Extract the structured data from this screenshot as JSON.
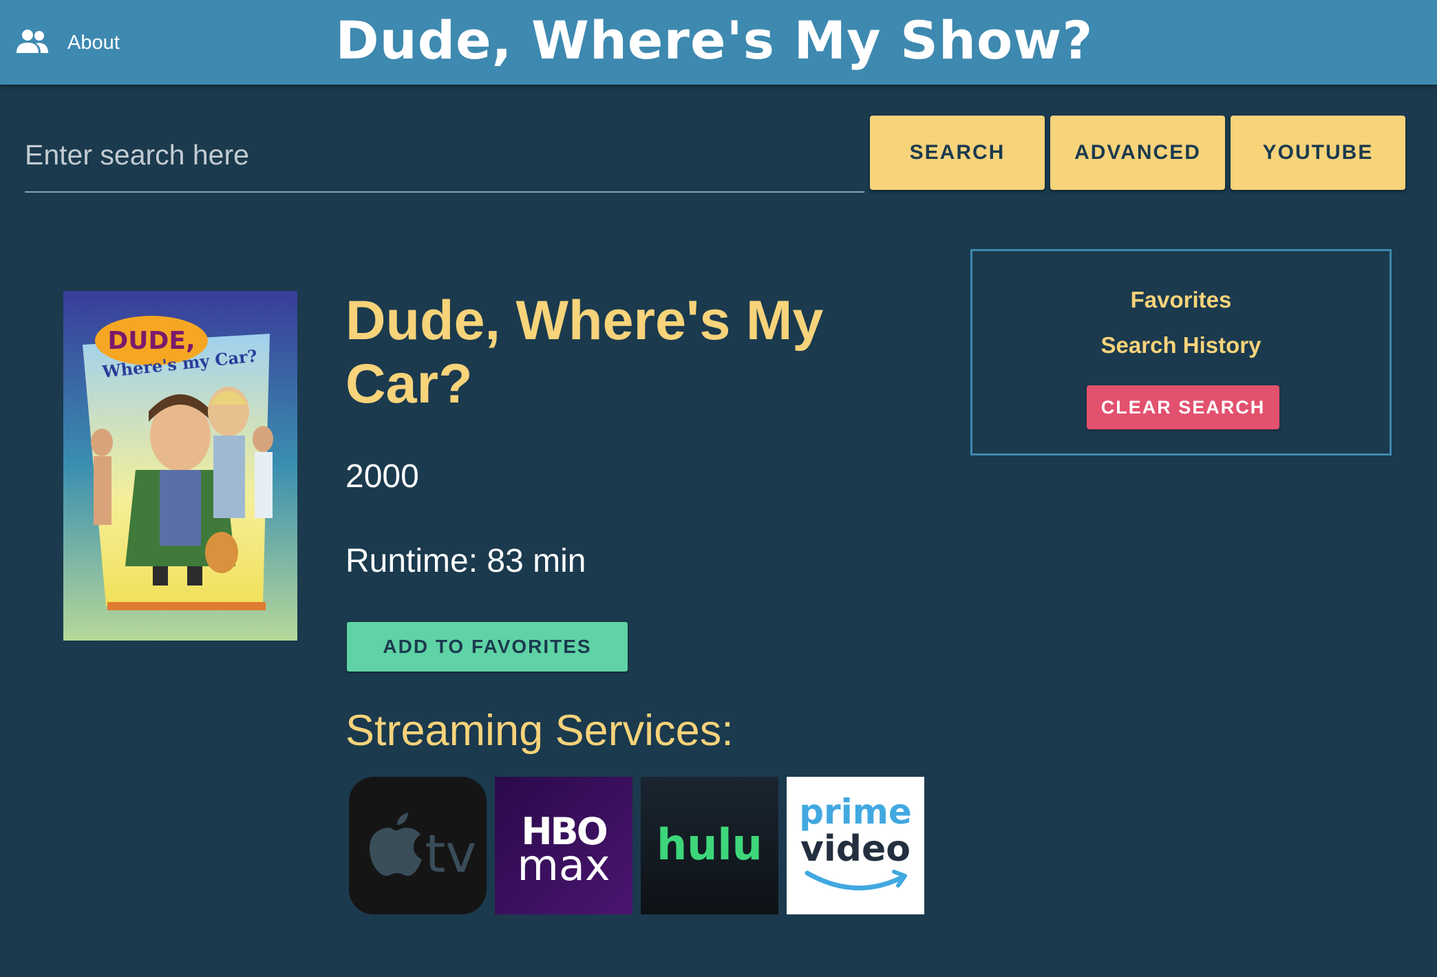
{
  "header": {
    "about_label": "About",
    "app_title": "Dude, Where's My Show?",
    "about_icon": "people-icon"
  },
  "search": {
    "placeholder": "Enter search here",
    "buttons": [
      "SEARCH",
      "ADVANCED",
      "YOUTUBE"
    ]
  },
  "movie": {
    "title": "Dude, Where's My Car?",
    "year": "2000",
    "runtime": "Runtime: 83 min",
    "add_favorites_label": "ADD TO FAVORITES",
    "poster": {
      "title_line1": "DUDE,",
      "title_line2": "Where's my Car?"
    }
  },
  "streaming": {
    "heading": "Streaming Services:",
    "services": [
      {
        "name": "Apple TV",
        "icon": "apple-tv-logo",
        "text": "tv"
      },
      {
        "name": "HBO Max",
        "icon": "hbo-max-logo",
        "text_top": "HBO",
        "text_bottom": "max"
      },
      {
        "name": "Hulu",
        "icon": "hulu-logo",
        "text": "hulu"
      },
      {
        "name": "Prime Video",
        "icon": "prime-video-logo",
        "text_top": "prime",
        "text_bottom": "video"
      }
    ]
  },
  "sidebar": {
    "favorites_label": "Favorites",
    "search_history_label": "Search History",
    "clear_search_label": "CLEAR SEARCH"
  },
  "colors": {
    "background": "#1b3a4e",
    "header": "#3e89b0",
    "accent_yellow": "#f7d37a",
    "favorites_green": "#5fd3a5",
    "clear_red": "#e2516e"
  }
}
